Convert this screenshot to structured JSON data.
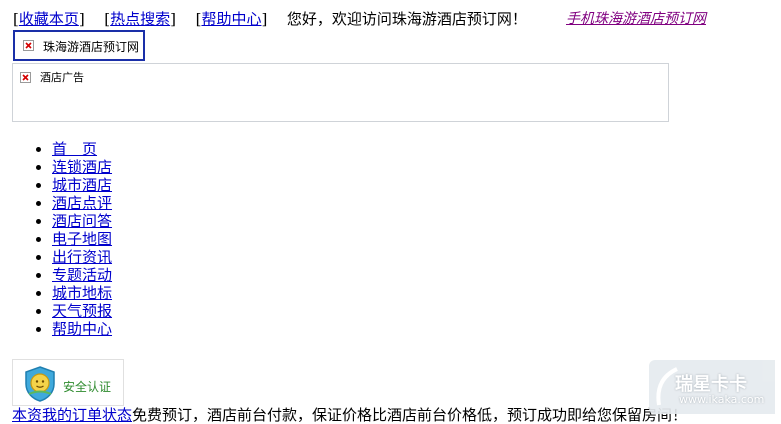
{
  "topbar": {
    "favorite_label": "收藏本页",
    "hot_search_label": "热点搜索",
    "help_center_label": "帮助中心",
    "welcome_text": "您好，欢迎访问珠海游酒店预订网！",
    "mobile_link_label": "手机珠海游酒店预订网"
  },
  "logo": {
    "alt_text": "珠海游酒店预订网"
  },
  "ad": {
    "alt_text": "酒店广告"
  },
  "nav": {
    "items": [
      "首　页",
      "连锁酒店",
      "城市酒店",
      "酒店点评",
      "酒店问答",
      "电子地图",
      "出行资讯",
      "专题活动",
      "城市地标",
      "天气预报",
      "帮助中心"
    ]
  },
  "security": {
    "label": "安全认证"
  },
  "bottom": {
    "link_text": "本资我的订单状态",
    "rest_text": "免费预订，酒店前台付款，保证价格比酒店前台价格低，预订成功即给您保留房间！"
  },
  "watermark": {
    "title": "瑞星卡卡",
    "url": "www.ikaka.com"
  },
  "colors": {
    "link": "#0000cc",
    "visited": "#800080",
    "logo_border": "#1a2fa8",
    "security_green": "#2e8b2e"
  }
}
